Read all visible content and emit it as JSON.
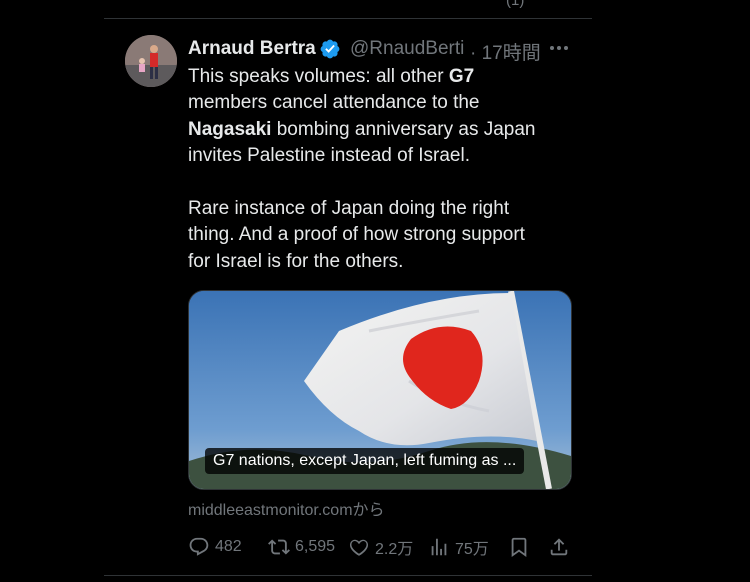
{
  "tweet": {
    "author": {
      "name": "Arnaud Bertra",
      "handle": "@RnaudBerti",
      "time": "· 17時間",
      "verified": true
    },
    "text": {
      "line1": [
        "This speaks volumes: all other ",
        "G7"
      ],
      "line2": "members cancel attendance to the",
      "line3": [
        "Nagasaki",
        " bombing anniversary as Japan"
      ],
      "line4": "invites Palestine instead of Israel.",
      "line5": "Rare instance of Japan doing the right",
      "line6": "thing. And a proof of how strong support",
      "line7": "for Israel is for the others."
    },
    "card": {
      "caption": "G7 nations, except Japan, left fuming as ...",
      "source": "middleeastmonitor.comから"
    },
    "actions": {
      "replies": "482",
      "retweets": "6,595",
      "likes": "2.2万",
      "views": "75万"
    }
  },
  "colors": {
    "background": "#000000",
    "text": "#e7e9ea",
    "secondary": "#71767b",
    "verified": "#1d9bf0",
    "flag_red": "#e0261d"
  }
}
